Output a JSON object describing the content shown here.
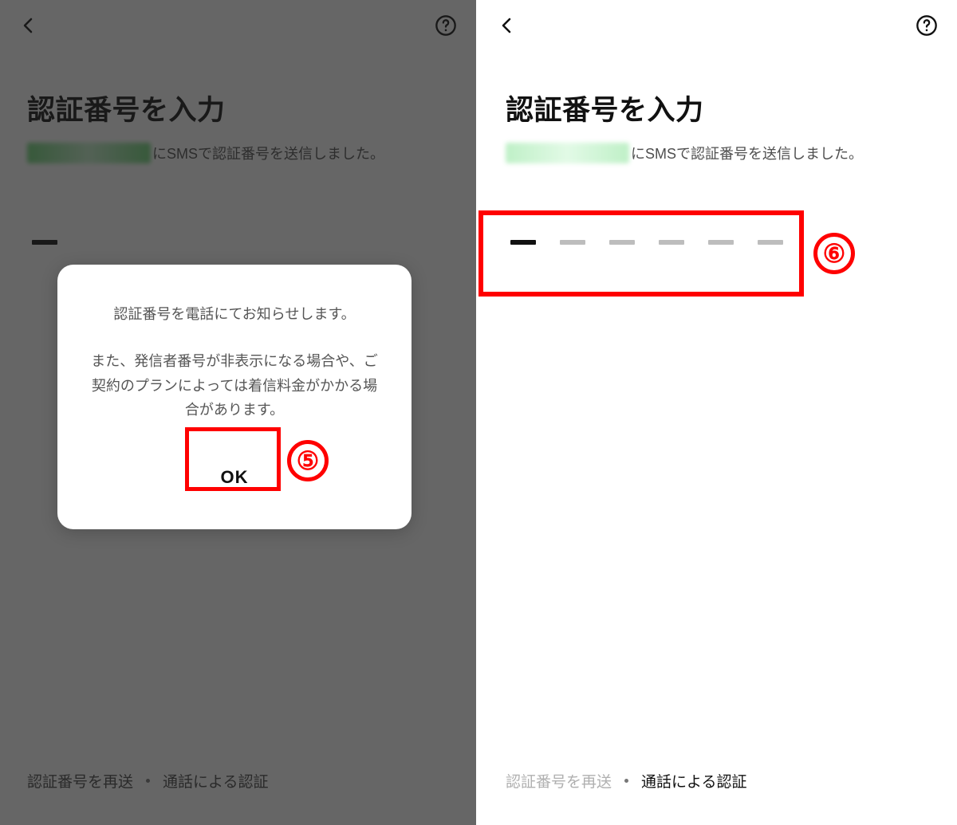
{
  "left": {
    "title": "認証番号を入力",
    "subtitle_tail": "にSMSで認証番号を送信しました。",
    "modal": {
      "line1": "認証番号を電話にてお知らせします。",
      "line2": "また、発信者番号が非表示になる場合や、ご契約のプランによっては着信料金がかかる場合があります。",
      "ok_label": "OK"
    },
    "bottom": {
      "resend": "認証番号を再送",
      "call_auth": "通話による認証"
    },
    "annotation_number": "⑤"
  },
  "right": {
    "title": "認証番号を入力",
    "subtitle_tail": "にSMSで認証番号を送信しました。",
    "bottom": {
      "resend": "認証番号を再送",
      "call_auth": "通話による認証"
    },
    "annotation_number": "⑥"
  }
}
